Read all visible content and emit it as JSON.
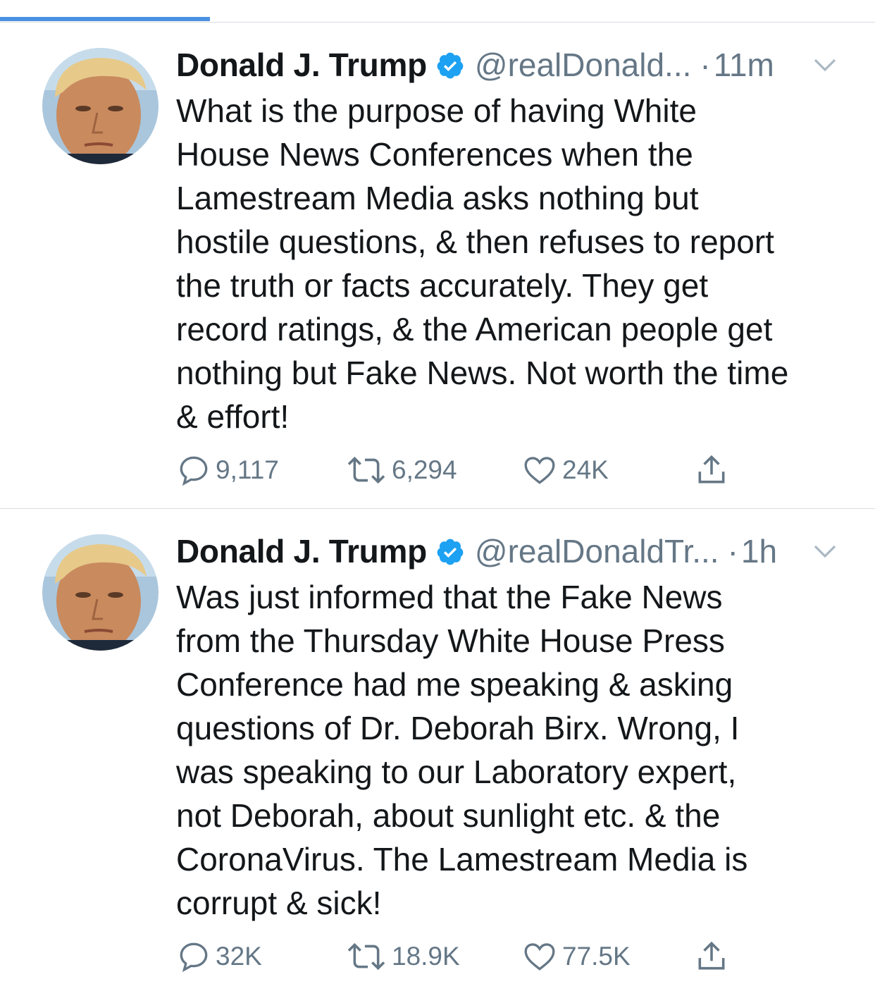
{
  "colors": {
    "accent": "#4a90e2",
    "verified": "#1da1f2",
    "muted": "#657786",
    "text": "#14171a",
    "divider": "#d9dde1"
  },
  "tweets": [
    {
      "name": "Donald J. Trump",
      "handle": "@realDonald...",
      "dot": "·",
      "time": "11m",
      "text": "What is the purpose of having White\nHouse News Conferences when the\nLamestream Media asks nothing but\nhostile questions, & then refuses to report\nthe truth or facts accurately. They get\nrecord ratings, & the American people get\nnothing but Fake News. Not worth the time\n& effort!",
      "replies": "9,117",
      "retweets": "6,294",
      "likes": "24K",
      "icons": [
        "reply-icon",
        "retweet-icon",
        "like-icon",
        "share-icon"
      ]
    },
    {
      "name": "Donald J. Trump",
      "handle": "@realDonaldTr...",
      "dot": "·",
      "time": "1h",
      "text": "Was just informed that the Fake News\nfrom the Thursday White House Press\nConference had me speaking & asking\nquestions of Dr. Deborah Birx. Wrong, I\nwas speaking to our Laboratory expert,\nnot Deborah, about sunlight etc. & the\nCoronaVirus. The Lamestream Media is\ncorrupt & sick!",
      "replies": "32K",
      "retweets": "18.9K",
      "likes": "77.5K",
      "icons": [
        "reply-icon",
        "retweet-icon",
        "like-icon",
        "share-icon"
      ]
    }
  ]
}
